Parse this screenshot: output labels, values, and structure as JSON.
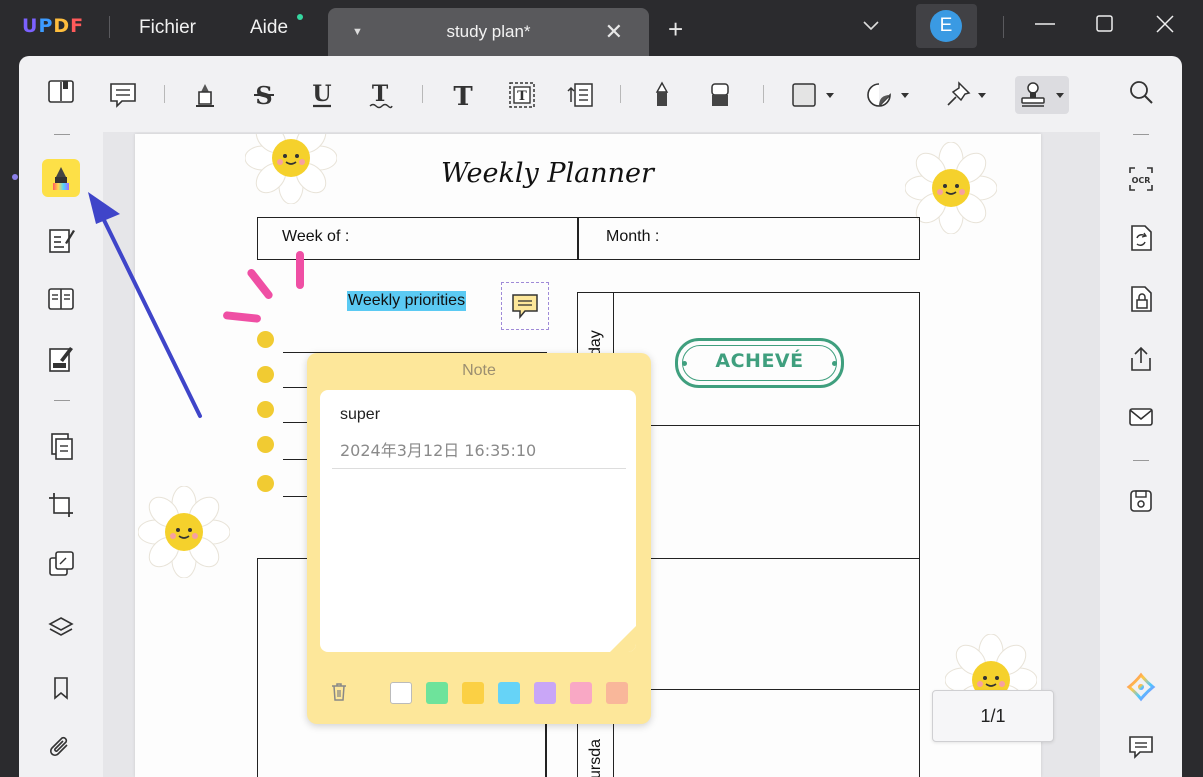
{
  "app": {
    "logo": "UPDF",
    "logo_letters": [
      "U",
      "P",
      "D",
      "F"
    ]
  },
  "menu": {
    "file": "Fichier",
    "help": "Aide"
  },
  "tab": {
    "title": "study plan*"
  },
  "account": {
    "initial": "E"
  },
  "document": {
    "title": "Weekly Planner",
    "week_label": "Week of :",
    "month_label": "Month :",
    "priorities_label": "Weekly priorities",
    "day_partial_1": "day",
    "day_partial_2": "ursda",
    "stamp_text": "ACHEVÉ"
  },
  "note": {
    "header": "Note",
    "text": "super",
    "timestamp": "2024年3月12日 16:35:10",
    "colors": [
      "#ffffff",
      "#6ee39b",
      "#fbd044",
      "#66d3f7",
      "#c9a6f7",
      "#f9a8c5",
      "#f9b79a"
    ]
  },
  "page_indicator": "1/1",
  "colors": {
    "accent_highlight": "#5bcaf3",
    "stamp": "#3f9f7e",
    "marker_dash": "#ef4fa4",
    "active_tool": "#fde047",
    "arrow": "#3f45c9"
  }
}
